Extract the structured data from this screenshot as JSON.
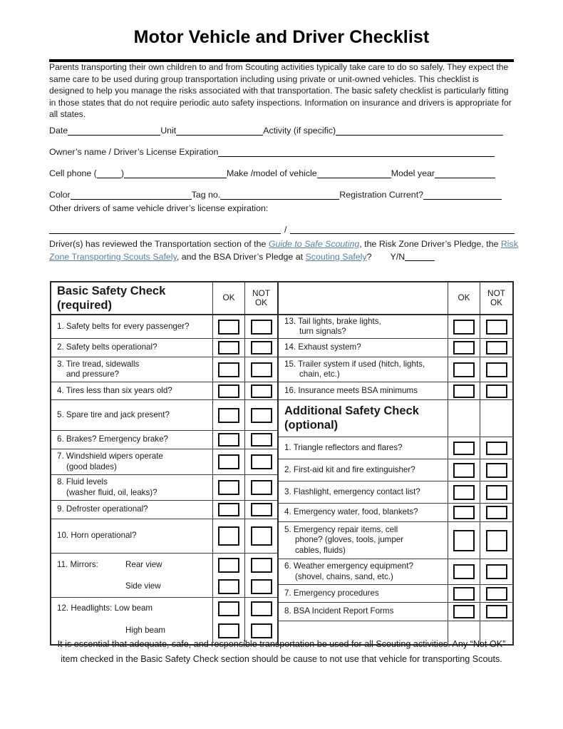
{
  "document": {
    "title": "Motor Vehicle and Driver  Checklist",
    "intro": "Parents transporting their own children to and from Scouting activities typically take care to do so safely. They expect the same care to be used during group transportation including using private or unit-owned vehicles. This checklist is designed to help you manage the risks associated with that transportation. The basic safety checklist is particularly fitting in those states that do not require periodic auto safety inspections. Information on insurance and drivers is appropriate for all states.",
    "footer": "It is essential that adequate, safe, and responsible transportation be used for all Scouting activities. Any “Not OK” item checked in the Basic Safety Check section should be cause to not use that vehicle for transporting Scouts."
  },
  "form": {
    "date_label": "Date",
    "unit_label": "Unit",
    "activity_label": "Activity (if specific)",
    "owner_label": "Owner’s name / Driver’s License Expiration",
    "cell_phone_label": "Cell phone (",
    "cell_phone_label_close": ")",
    "make_model_label": "Make /model of vehicle",
    "model_year_label": "Model year",
    "color_label": "Color",
    "tag_no_label": "Tag no.",
    "registration_label": "Registration Current?",
    "other_drivers_label": "Other drivers of same vehicle driver’s license expiration:",
    "other_drivers_separator": "/"
  },
  "reviewed": {
    "part1": "Driver(s) has reviewed the Transportation section of the ",
    "link1": "Guide to Safe Scouting",
    "part2": ", the Risk Zone Driver’s Pledge, the ",
    "link2": "Risk Zone Transporting Scouts Safely",
    "part3": ", and the BSA Driver’s Pledge at ",
    "link3": "Scouting Safely",
    "part4": "?",
    "yn_label": "Y/N",
    "link_color": "#5b7fa3"
  },
  "table": {
    "headers": {
      "basic_title": "Basic Safety Check (required)",
      "basic_title_line1": "Basic Safety Check",
      "basic_title_line2": "(required)",
      "ok": "OK",
      "not_ok_line1": "NOT",
      "not_ok_line2": "OK",
      "right_header_blank": ""
    },
    "additional_title_line1": "Additional Safety Check",
    "additional_title_line2": "(optional)",
    "basic_items": [
      {
        "n": "1.",
        "text": "Safety belts for every passenger?"
      },
      {
        "n": "2.",
        "text": "Safety belts operational?"
      },
      {
        "n": "3.",
        "text": "Tire tread, sidewalls",
        "text2": "and pressure?"
      },
      {
        "n": "4.",
        "text": "Tires less than six years old?"
      },
      {
        "n": "5.",
        "text": "Spare tire and jack present?"
      },
      {
        "n": "6.",
        "text": "Brakes? Emergency brake?"
      },
      {
        "n": "7.",
        "text": "Windshield wipers operate",
        "text2": "(good blades)"
      },
      {
        "n": "8.",
        "text": "Fluid levels",
        "text2": "(washer fluid, oil, leaks)?"
      },
      {
        "n": "9.",
        "text": "Defroster operational?"
      },
      {
        "n": "10.",
        "text": "Horn operational?"
      },
      {
        "n": "11.",
        "text": "Mirrors:",
        "sub": "Rear view"
      },
      {
        "n": "",
        "text": "",
        "sub": "Side view"
      },
      {
        "n": "12.",
        "text": "Headlights: Low beam"
      },
      {
        "n": "",
        "text": "",
        "sub": "High beam"
      }
    ],
    "right_items": [
      {
        "n": "13.",
        "text": "Tail lights, brake lights,",
        "text2": "turn signals?"
      },
      {
        "n": "14.",
        "text": "Exhaust system?"
      },
      {
        "n": "15.",
        "text": "Trailer system if used (hitch, lights,",
        "text2": "chain, etc.)"
      },
      {
        "n": "16.",
        "text": "Insurance meets BSA minimums"
      }
    ],
    "additional_items": [
      {
        "n": "1.",
        "text": "Triangle reflectors and flares?"
      },
      {
        "n": "2.",
        "text": "First-aid kit and fire extinguisher?"
      },
      {
        "n": "3.",
        "text": "Flashlight, emergency contact list?"
      },
      {
        "n": "4.",
        "text": "Emergency water, food, blankets?"
      },
      {
        "n": "5.",
        "text": "Emergency repair items, cell",
        "text2": "phone? (gloves, tools, jumper",
        "text3": "cables, fluids)"
      },
      {
        "n": "6.",
        "text": "Weather emergency equipment?",
        "text2": "(shovel, chains, sand, etc.)"
      },
      {
        "n": "7.",
        "text": "Emergency procedures"
      },
      {
        "n": "8.",
        "text": "BSA Incident Report Forms"
      }
    ]
  }
}
